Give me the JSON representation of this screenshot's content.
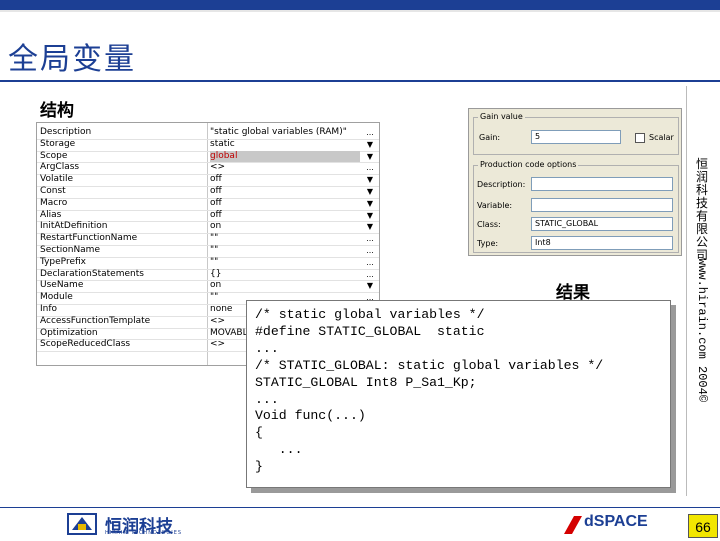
{
  "slide": {
    "title": "全局变量",
    "section_structure": "结构",
    "section_result": "结果",
    "watermark_company": "恒润科技有限公司",
    "watermark_url": "www.hirain.com 2004©",
    "page_number": "66"
  },
  "property_grid": {
    "rows": [
      {
        "name": "Description",
        "value": "\"static global variables (RAM)\"",
        "button": "..."
      },
      {
        "name": "Storage",
        "value": "static",
        "button": "▼"
      },
      {
        "name": "Scope",
        "value": "global",
        "button": "▼",
        "selected": true
      },
      {
        "name": "ArgClass",
        "value": "<>",
        "button": "..."
      },
      {
        "name": "Volatile",
        "value": "off",
        "button": "▼"
      },
      {
        "name": "Const",
        "value": "off",
        "button": "▼"
      },
      {
        "name": "Macro",
        "value": "off",
        "button": "▼"
      },
      {
        "name": "Alias",
        "value": "off",
        "button": "▼"
      },
      {
        "name": "InitAtDefinition",
        "value": "on",
        "button": "▼"
      },
      {
        "name": "RestartFunctionName",
        "value": "\"\"",
        "button": "..."
      },
      {
        "name": "SectionName",
        "value": "\"\"",
        "button": "..."
      },
      {
        "name": "TypePrefix",
        "value": "\"\"",
        "button": "..."
      },
      {
        "name": "DeclarationStatements",
        "value": "{}",
        "button": "..."
      },
      {
        "name": "UseName",
        "value": "on",
        "button": "▼"
      },
      {
        "name": "Module",
        "value": "\"\"",
        "button": "..."
      },
      {
        "name": "Info",
        "value": "none",
        "button": "▼"
      },
      {
        "name": "AccessFunctionTemplate",
        "value": "<>",
        "button": "..."
      },
      {
        "name": "Optimization",
        "value": "MOVABLE",
        "button": ""
      },
      {
        "name": "ScopeReducedClass",
        "value": "<>",
        "button": ""
      }
    ]
  },
  "dialog": {
    "gain_group": "Gain value",
    "gain_label": "Gain:",
    "gain_value": "5",
    "scalar_label": "Scalar",
    "code_group": "Production code options",
    "description_label": "Description:",
    "description_value": "",
    "variable_label": "Variable:",
    "variable_value": "",
    "class_label": "Class:",
    "class_value": "STATIC_GLOBAL",
    "type_label": "Type:",
    "type_value": "Int8"
  },
  "code": {
    "lines": [
      "/* static global variables */",
      "#define STATIC_GLOBAL  static",
      "...",
      "/* STATIC_GLOBAL: static global variables */",
      "STATIC_GLOBAL Int8 P_Sa1_Kp;",
      "...",
      "Void func(...)",
      "{",
      "   ...",
      "}"
    ]
  },
  "footer": {
    "hirain_name": "恒润科技",
    "hirain_sub": "HIRAIN TECHNOLOGIES",
    "dspace_name": "dSPACE"
  },
  "colors": {
    "brand_blue": "#1c3f94",
    "selected_text": "#c00000",
    "page_badge": "#f2e600"
  }
}
